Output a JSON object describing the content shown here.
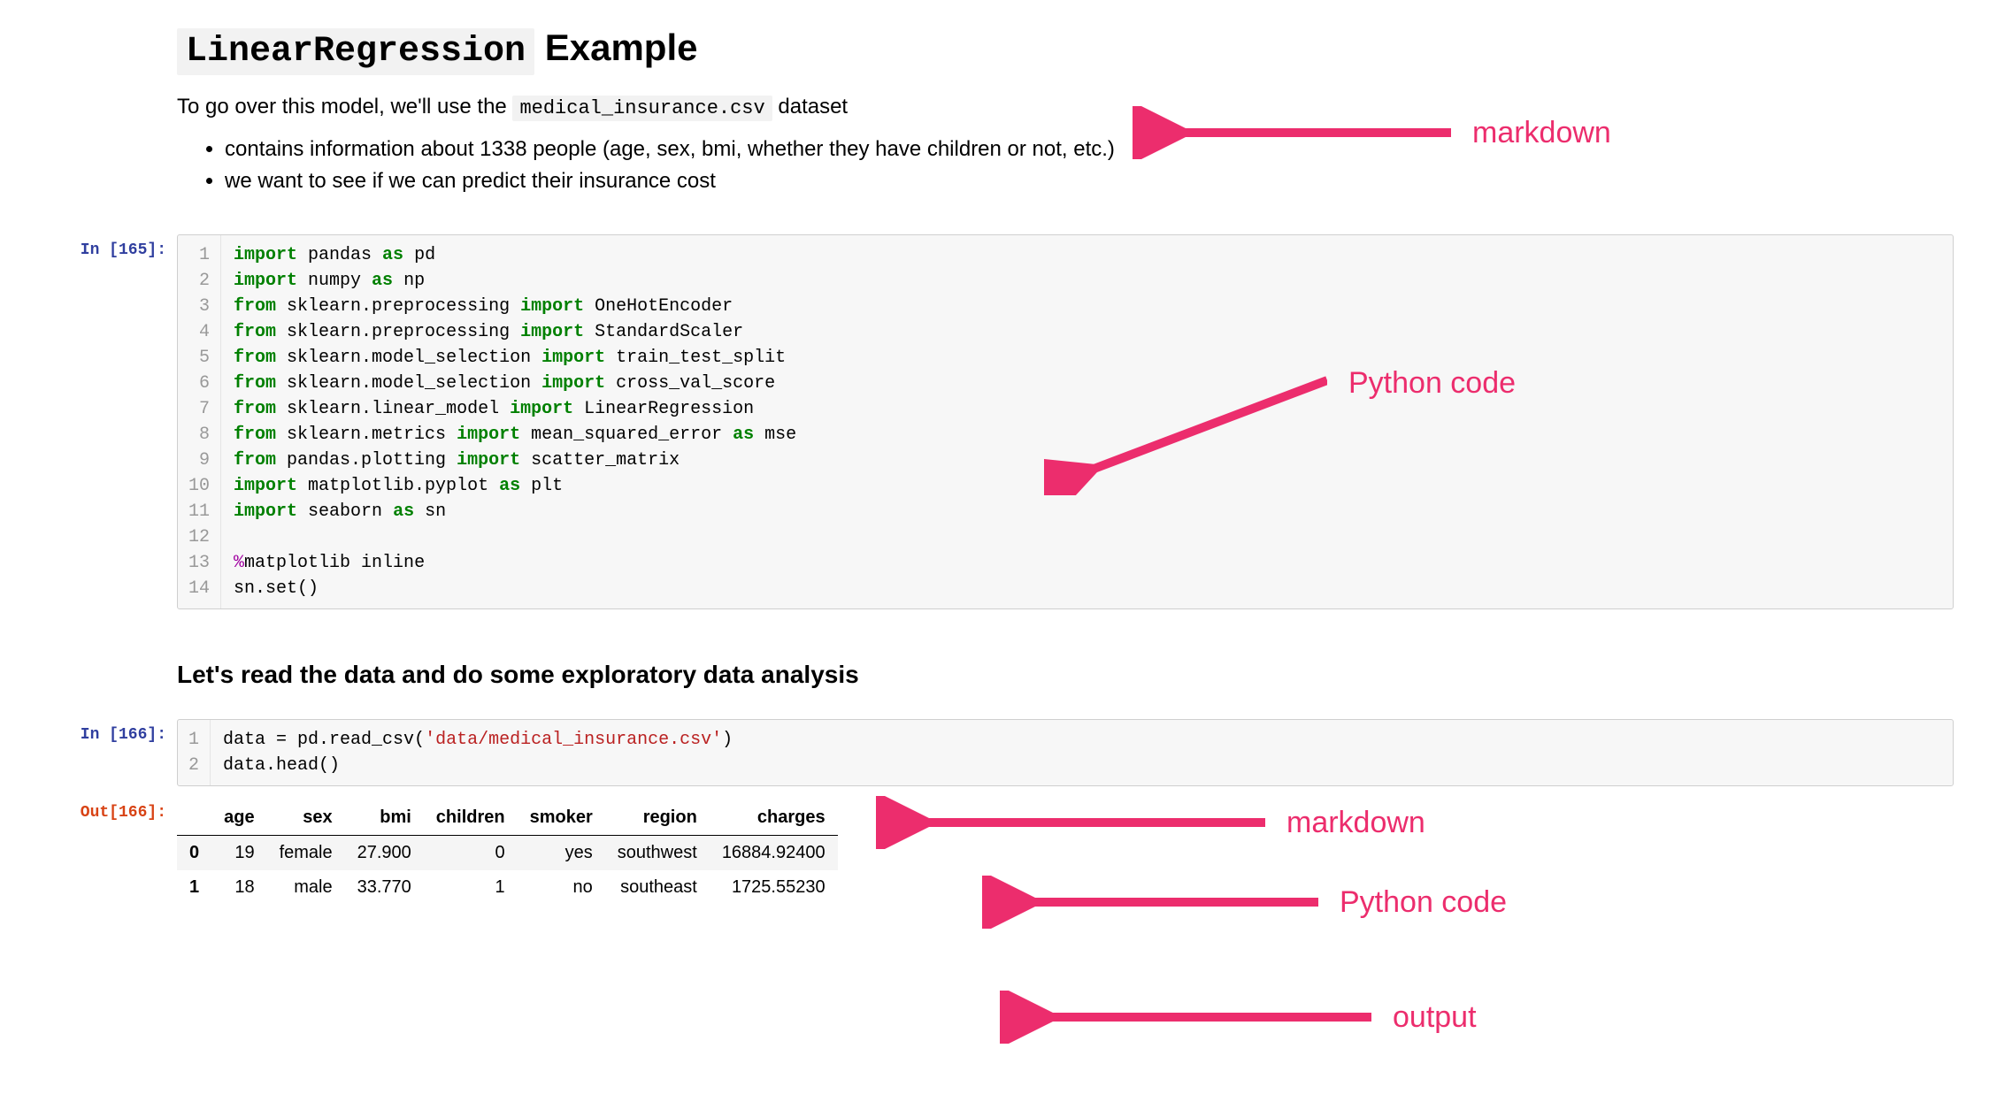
{
  "markdown1": {
    "title_code": "LinearRegression",
    "title_rest": " Example",
    "intro_pre": "To go over this model, we'll use the ",
    "intro_code": "medical_insurance.csv",
    "intro_post": " dataset",
    "bullets": [
      "contains information about 1338 people (age, sex, bmi, whether they have children or not, etc.)",
      "we want to see if we can predict their insurance cost"
    ]
  },
  "code1": {
    "prompt": "In [165]:",
    "lines": [
      [
        {
          "t": "import",
          "c": "kw"
        },
        {
          "t": " pandas "
        },
        {
          "t": "as",
          "c": "kw"
        },
        {
          "t": " pd"
        }
      ],
      [
        {
          "t": "import",
          "c": "kw"
        },
        {
          "t": " numpy "
        },
        {
          "t": "as",
          "c": "kw"
        },
        {
          "t": " np"
        }
      ],
      [
        {
          "t": "from",
          "c": "kw"
        },
        {
          "t": " sklearn.preprocessing "
        },
        {
          "t": "import",
          "c": "kw"
        },
        {
          "t": " OneHotEncoder"
        }
      ],
      [
        {
          "t": "from",
          "c": "kw"
        },
        {
          "t": " sklearn.preprocessing "
        },
        {
          "t": "import",
          "c": "kw"
        },
        {
          "t": " StandardScaler"
        }
      ],
      [
        {
          "t": "from",
          "c": "kw"
        },
        {
          "t": " sklearn.model_selection "
        },
        {
          "t": "import",
          "c": "kw"
        },
        {
          "t": " train_test_split"
        }
      ],
      [
        {
          "t": "from",
          "c": "kw"
        },
        {
          "t": " sklearn.model_selection "
        },
        {
          "t": "import",
          "c": "kw"
        },
        {
          "t": " cross_val_score"
        }
      ],
      [
        {
          "t": "from",
          "c": "kw"
        },
        {
          "t": " sklearn.linear_model "
        },
        {
          "t": "import",
          "c": "kw"
        },
        {
          "t": " LinearRegression"
        }
      ],
      [
        {
          "t": "from",
          "c": "kw"
        },
        {
          "t": " sklearn.metrics "
        },
        {
          "t": "import",
          "c": "kw"
        },
        {
          "t": " mean_squared_error "
        },
        {
          "t": "as",
          "c": "kw"
        },
        {
          "t": " mse"
        }
      ],
      [
        {
          "t": "from",
          "c": "kw"
        },
        {
          "t": " pandas.plotting "
        },
        {
          "t": "import",
          "c": "kw"
        },
        {
          "t": " scatter_matrix"
        }
      ],
      [
        {
          "t": "import",
          "c": "kw"
        },
        {
          "t": " matplotlib.pyplot "
        },
        {
          "t": "as",
          "c": "kw"
        },
        {
          "t": " plt"
        }
      ],
      [
        {
          "t": "import",
          "c": "kw"
        },
        {
          "t": " seaborn "
        },
        {
          "t": "as",
          "c": "kw"
        },
        {
          "t": " sn"
        }
      ],
      [
        {
          "t": " "
        }
      ],
      [
        {
          "t": "%",
          "c": "mag"
        },
        {
          "t": "matplotlib inline"
        }
      ],
      [
        {
          "t": "sn.set()"
        }
      ]
    ]
  },
  "markdown2": {
    "heading": "Let's read the data and do some exploratory data analysis"
  },
  "code2": {
    "prompt": "In [166]:",
    "lines": [
      [
        {
          "t": "data = pd.read_csv("
        },
        {
          "t": "'data/medical_insurance.csv'",
          "c": "str"
        },
        {
          "t": ")"
        }
      ],
      [
        {
          "t": "data.head()"
        }
      ]
    ]
  },
  "out1": {
    "prompt": "Out[166]:",
    "columns": [
      "age",
      "sex",
      "bmi",
      "children",
      "smoker",
      "region",
      "charges"
    ],
    "rows": [
      {
        "idx": "0",
        "cells": [
          "19",
          "female",
          "27.900",
          "0",
          "yes",
          "southwest",
          "16884.92400"
        ]
      },
      {
        "idx": "1",
        "cells": [
          "18",
          "male",
          "33.770",
          "1",
          "no",
          "southeast",
          "1725.55230"
        ]
      }
    ]
  },
  "annotations": {
    "a1": "markdown",
    "a2": "Python code",
    "a3": "markdown",
    "a4": "Python code",
    "a5": "output"
  },
  "colors": {
    "annotation": "#ec2d6d",
    "keyword": "#008000",
    "string": "#ba2121",
    "prompt_in": "#303f9f",
    "prompt_out": "#d84315"
  }
}
